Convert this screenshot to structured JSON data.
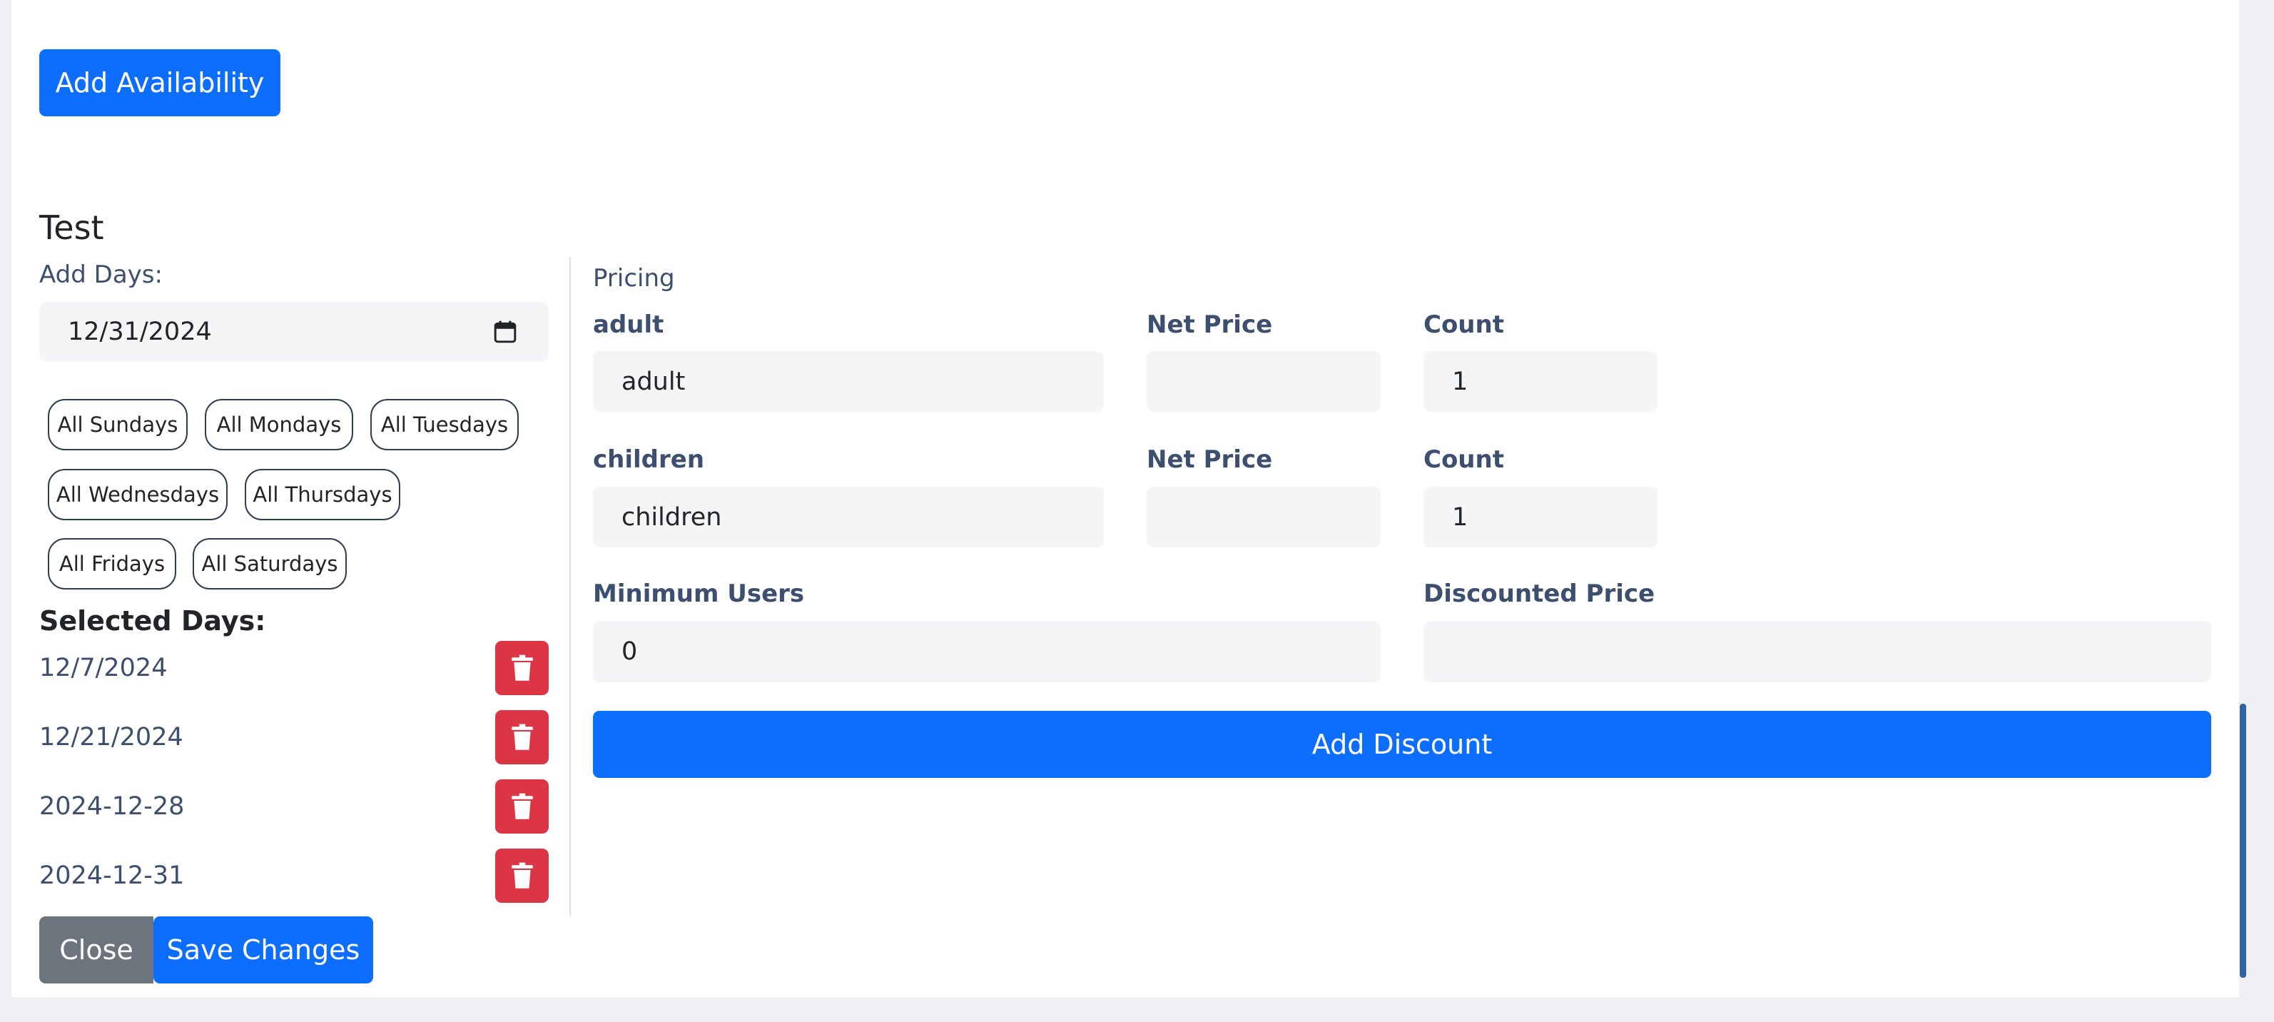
{
  "toolbar": {
    "add_availability_label": "Add Availability"
  },
  "section": {
    "title": "Test",
    "add_days_label": "Add Days:",
    "date_input_value": "12/31/2024",
    "day_pills": [
      "All Sundays",
      "All Mondays",
      "All Tuesdays",
      "All Wednesdays",
      "All Thursdays",
      "All Fridays",
      "All Saturdays"
    ],
    "selected_days_label": "Selected Days:",
    "selected_days": [
      "12/7/2024",
      "12/21/2024",
      "2024-12-28",
      "2024-12-31"
    ]
  },
  "pricing": {
    "title": "Pricing",
    "rows": [
      {
        "type_label": "adult",
        "type_value": "adult",
        "net_price_label": "Net Price",
        "net_price_value": "",
        "count_label": "Count",
        "count_value": "1"
      },
      {
        "type_label": "children",
        "type_value": "children",
        "net_price_label": "Net Price",
        "net_price_value": "",
        "count_label": "Count",
        "count_value": "1"
      }
    ],
    "minimum_users_label": "Minimum Users",
    "minimum_users_value": "0",
    "discounted_price_label": "Discounted Price",
    "discounted_price_value": "",
    "add_discount_label": "Add Discount"
  },
  "footer": {
    "close_label": "Close",
    "save_label": "Save Changes"
  },
  "colors": {
    "primary": "#0d6efd",
    "danger": "#dc3545",
    "secondary": "#6c757d",
    "label": "#3d4f6e"
  },
  "icons": {
    "trash": "trash-icon",
    "calendar": "calendar-icon"
  }
}
